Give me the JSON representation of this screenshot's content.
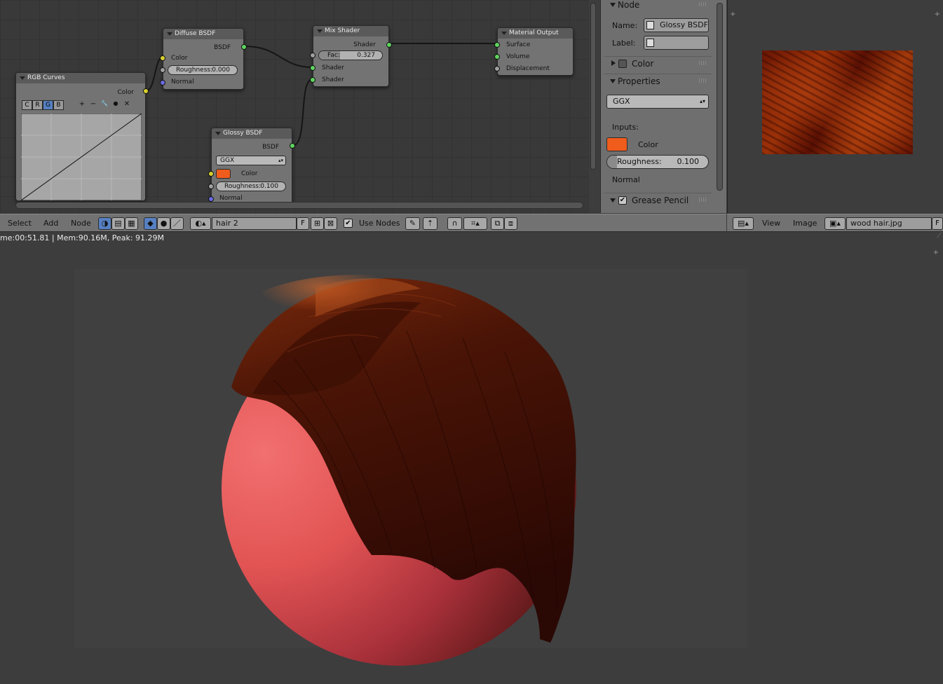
{
  "node_editor": {
    "nodes": {
      "rgb_curves": {
        "title": "RGB Curves",
        "output": "Color",
        "channel_buttons": [
          "C",
          "R",
          "G",
          "B"
        ],
        "active_channel": "G",
        "tool_icons": [
          "+",
          "−",
          "🔧",
          "●",
          "✕"
        ]
      },
      "diffuse": {
        "title": "Diffuse BSDF",
        "output": "BSDF",
        "inputs": [
          "Color",
          "Roughness:",
          "Normal"
        ],
        "roughness": "0.000"
      },
      "glossy": {
        "title": "Glossy BSDF",
        "output": "BSDF",
        "distribution": "GGX",
        "color_label": "Color",
        "roughness_label": "Roughness:",
        "roughness": "0.100",
        "normal_label": "Normal"
      },
      "mix": {
        "title": "Mix Shader",
        "output": "Shader",
        "fac_label": "Fac:",
        "fac": "0.327",
        "inputs": [
          "Shader",
          "Shader"
        ]
      },
      "output": {
        "title": "Material Output",
        "inputs": [
          "Surface",
          "Volume",
          "Displacement"
        ]
      }
    }
  },
  "properties": {
    "node_panel": "Node",
    "name_label": "Name:",
    "name_value": "Glossy BSDF",
    "label_label": "Label:",
    "label_value": "",
    "color_panel": "Color",
    "properties_panel": "Properties",
    "distribution": "GGX",
    "inputs_label": "Inputs:",
    "color_label": "Color",
    "color_value": "#f05c1c",
    "roughness_label": "Roughness:",
    "roughness_value": "0.100",
    "roughness_fraction": 0.1,
    "normal_label": "Normal",
    "grease_panel": "Grease Pencil"
  },
  "node_header": {
    "menus": [
      "Select",
      "Add",
      "Node"
    ],
    "material_name": "hair 2",
    "fake_user": "F",
    "use_nodes_label": "Use Nodes",
    "use_nodes_checked": true
  },
  "image_header": {
    "menus": [
      "View",
      "Image"
    ],
    "image_name": "wood hair.jpg",
    "fake_user": "F"
  },
  "render": {
    "status": "me:00:51.81 | Mem:90.16M, Peak: 91.29M"
  }
}
